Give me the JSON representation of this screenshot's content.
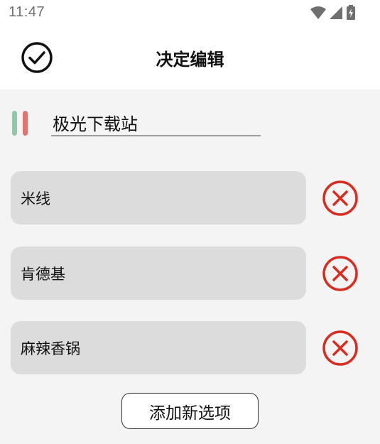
{
  "status_bar": {
    "time": "11:47",
    "icons": [
      "wifi-icon",
      "cellular-signal-icon",
      "battery-charging-icon"
    ]
  },
  "header": {
    "title": "决定编辑",
    "confirm_icon": "check-circle-icon"
  },
  "decision": {
    "name_value": "极光下载站"
  },
  "options": [
    {
      "label": "米线",
      "delete_icon": "remove-circle-icon"
    },
    {
      "label": "肯德基",
      "delete_icon": "remove-circle-icon"
    },
    {
      "label": "麻辣香锅",
      "delete_icon": "remove-circle-icon"
    }
  ],
  "add_button_label": "添加新选项",
  "colors": {
    "delete_red": "#d92b1f",
    "handle_green": "#8ec9a3",
    "handle_red": "#e07470",
    "option_bg": "#dcdcdc",
    "page_bg": "#f4f4f4"
  }
}
